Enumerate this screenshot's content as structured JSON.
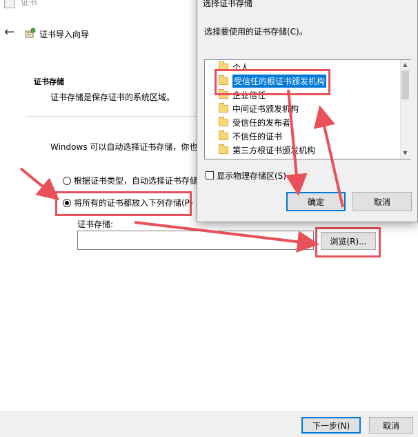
{
  "wizard": {
    "title_bar_text": "证书",
    "heading": "证书导入向导",
    "section_title": "证书存储",
    "section_desc": "证书存储是保存证书的系统区域。",
    "auto_text": "Windows 可以自动选择证书存储，你也",
    "radio_auto_label": "根据证书类型，自动选择证书存储",
    "radio_manual_label": "将所有的证书都放入下列存储(P)",
    "store_label": "证书存储:",
    "store_value": "",
    "browse_label": "浏览(R)...",
    "next_label": "下一步(N)",
    "cancel_label": "取消"
  },
  "dialog": {
    "title": "选择证书存储",
    "prompt": "选择要使用的证书存储(C)。",
    "stores": [
      "个人",
      "受信任的根证书颁发机构",
      "企业信任",
      "中间证书颁发机构",
      "受信任的发布者",
      "不信任的证书",
      "第三方根证书颁发机构"
    ],
    "selected_store": "受信任的根证书颁发机构",
    "show_physical_label": "显示物理存储区(S)",
    "ok_label": "确定",
    "cancel_label": "取消"
  },
  "colors": {
    "annotation_red": "#e8515a",
    "selection_blue": "#0078d7",
    "folder_yellow": "#f8d775"
  },
  "icons": {
    "back": "back-arrow-icon",
    "wizard": "certificate-wizard-icon",
    "folder": "folder-icon"
  }
}
